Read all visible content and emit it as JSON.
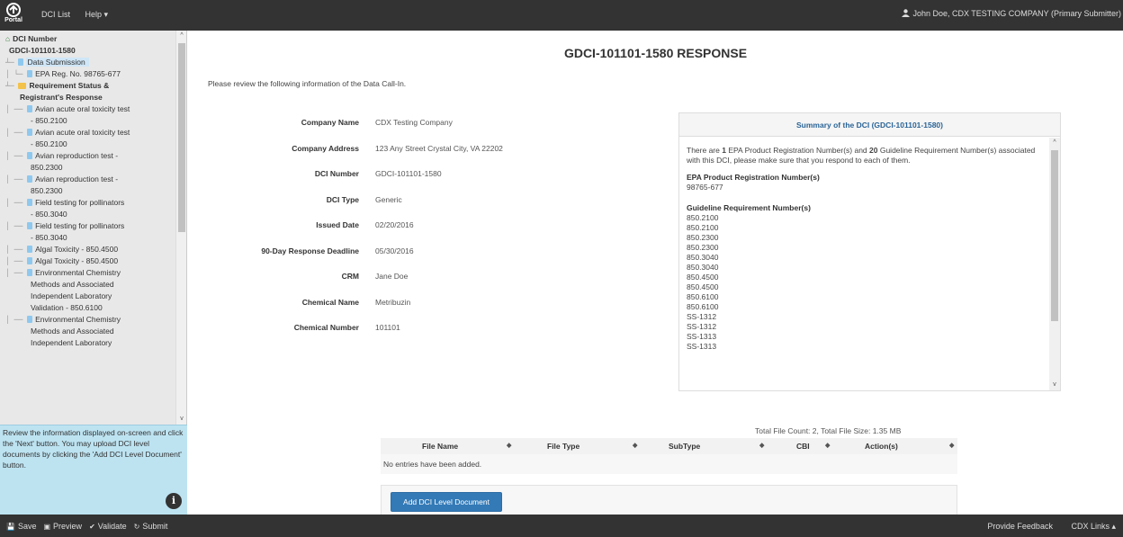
{
  "topbar": {
    "logo_text": "Portal",
    "nav": [
      "DCI List",
      "Help ▾"
    ],
    "user": "John Doe, CDX TESTING COMPANY (Primary Submitter)"
  },
  "sidebar": {
    "tree": [
      {
        "text": "DCI Number",
        "prefix": "",
        "icon": "home",
        "bold": true
      },
      {
        "text": "GDCI-101101-1580",
        "prefix": "",
        "icon": "none",
        "bold": true,
        "indent": 10
      },
      {
        "text": "Data Submission",
        "prefix": "┴─",
        "icon": "file",
        "selected": true
      },
      {
        "text": "EPA Reg. No. 98765-677",
        "prefix": "│ └─",
        "icon": "file"
      },
      {
        "text": "Requirement Status &",
        "prefix": "┴─",
        "icon": "folder",
        "bold": true
      },
      {
        "text": "Registrant's Response",
        "prefix": "",
        "icon": "none",
        "bold": true,
        "indent": 22
      },
      {
        "text": "Avian acute oral toxicity test",
        "prefix": "│ ──",
        "icon": "file"
      },
      {
        "text": "- 850.2100",
        "prefix": "",
        "icon": "none",
        "indent": 34
      },
      {
        "text": "Avian acute oral toxicity test",
        "prefix": "│ ──",
        "icon": "file"
      },
      {
        "text": "- 850.2100",
        "prefix": "",
        "icon": "none",
        "indent": 34
      },
      {
        "text": "Avian reproduction test -",
        "prefix": "│ ──",
        "icon": "file"
      },
      {
        "text": "850.2300",
        "prefix": "",
        "icon": "none",
        "indent": 34
      },
      {
        "text": "Avian reproduction test -",
        "prefix": "│ ──",
        "icon": "file"
      },
      {
        "text": "850.2300",
        "prefix": "",
        "icon": "none",
        "indent": 34
      },
      {
        "text": "Field testing for pollinators",
        "prefix": "│ ──",
        "icon": "file"
      },
      {
        "text": "- 850.3040",
        "prefix": "",
        "icon": "none",
        "indent": 34
      },
      {
        "text": "Field testing for pollinators",
        "prefix": "│ ──",
        "icon": "file"
      },
      {
        "text": "- 850.3040",
        "prefix": "",
        "icon": "none",
        "indent": 34
      },
      {
        "text": "Algal Toxicity - 850.4500",
        "prefix": "│ ──",
        "icon": "file"
      },
      {
        "text": "Algal Toxicity - 850.4500",
        "prefix": "│ ──",
        "icon": "file"
      },
      {
        "text": "Environmental Chemistry",
        "prefix": "│ ──",
        "icon": "file"
      },
      {
        "text": "Methods and Associated",
        "prefix": "",
        "icon": "none",
        "indent": 34
      },
      {
        "text": "Independent Laboratory",
        "prefix": "",
        "icon": "none",
        "indent": 34
      },
      {
        "text": "Validation - 850.6100",
        "prefix": "",
        "icon": "none",
        "indent": 34
      },
      {
        "text": "Environmental Chemistry",
        "prefix": "│ ──",
        "icon": "file"
      },
      {
        "text": "Methods and Associated",
        "prefix": "",
        "icon": "none",
        "indent": 34
      },
      {
        "text": "Independent Laboratory",
        "prefix": "",
        "icon": "none",
        "indent": 34
      }
    ],
    "help_text": "Review the information displayed on-screen and click the 'Next' button. You may upload DCI level documents by clicking the 'Add DCI Level Document' button."
  },
  "main": {
    "title": "GDCI-101101-1580 RESPONSE",
    "intro": "Please review the following information of the Data Call-In.",
    "fields": [
      {
        "label": "Company Name",
        "value": "CDX Testing Company"
      },
      {
        "label": "Company Address",
        "value": "123 Any Street Crystal City, VA 22202"
      },
      {
        "label": "DCI Number",
        "value": "GDCI-101101-1580"
      },
      {
        "label": "DCI Type",
        "value": "Generic"
      },
      {
        "label": "Issued Date",
        "value": "02/20/2016"
      },
      {
        "label": "90-Day Response Deadline",
        "value": "05/30/2016"
      },
      {
        "label": "CRM",
        "value": "Jane Doe"
      },
      {
        "label": "Chemical Name",
        "value": "Metribuzin"
      },
      {
        "label": "Chemical Number",
        "value": "101101"
      }
    ],
    "summary": {
      "title": "Summary of the DCI (GDCI-101101-1580)",
      "text_pre": "There are ",
      "reg_count": "1",
      "text_mid": " EPA Product Registration Number(s) and ",
      "guide_count": "20",
      "text_post": " Guideline Requirement Number(s) associated with this DCI, please make sure that you respond to each of them.",
      "reg_heading": "EPA Product Registration Number(s)",
      "reg_numbers": [
        "98765-677"
      ],
      "guide_heading": "Guideline Requirement Number(s)",
      "guide_numbers": [
        "850.2100",
        "850.2100",
        "850.2300",
        "850.2300",
        "850.3040",
        "850.3040",
        "850.4500",
        "850.4500",
        "850.6100",
        "850.6100",
        "SS-1312",
        "SS-1312",
        "SS-1313",
        "SS-1313"
      ]
    },
    "files": {
      "count_text": "Total File Count: 2, Total File Size: 1.35 MB",
      "columns": [
        "File Name",
        "File Type",
        "SubType",
        "CBI",
        "Action(s)"
      ],
      "empty_text": "No entries have been added.",
      "add_button": "Add DCI Level Document"
    }
  },
  "bottombar": {
    "actions": [
      {
        "label": "Save",
        "icon": "save-icon",
        "glyph": "💾"
      },
      {
        "label": "Preview",
        "icon": "camera-icon",
        "glyph": "▣"
      },
      {
        "label": "Validate",
        "icon": "check-icon",
        "glyph": "✔"
      },
      {
        "label": "Submit",
        "icon": "refresh-icon",
        "glyph": "↻"
      }
    ],
    "right": [
      "Provide Feedback",
      "CDX Links ▴"
    ]
  }
}
